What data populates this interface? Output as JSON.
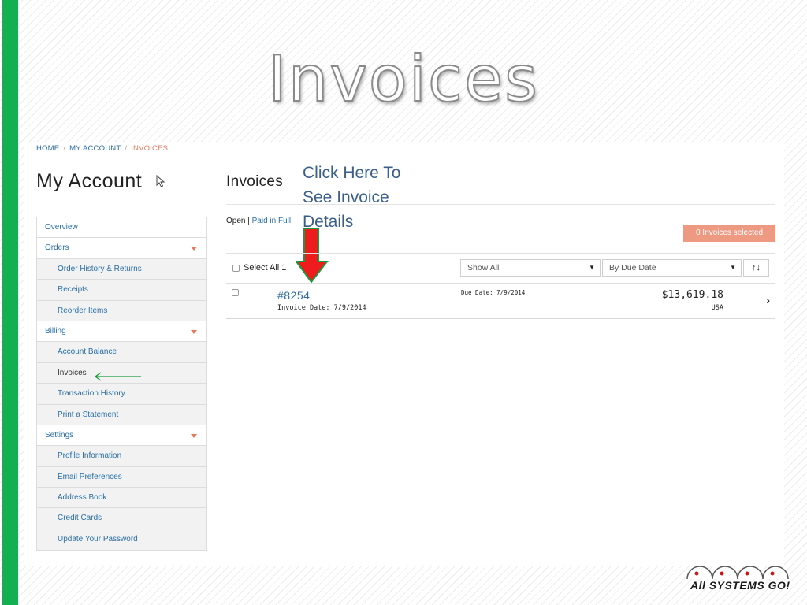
{
  "slide": {
    "title": "Invoices",
    "annotation": "Click Here To See Invoice Details",
    "accent_color": "#12b050"
  },
  "breadcrumb": {
    "home": "HOME",
    "account": "MY ACCOUNT",
    "current": "INVOICES"
  },
  "account": {
    "title": "My Account"
  },
  "sidebar": {
    "items": [
      {
        "label": "Overview",
        "sub": false,
        "caret": false
      },
      {
        "label": "Orders",
        "sub": false,
        "caret": true
      },
      {
        "label": "Order History & Returns",
        "sub": true,
        "caret": false
      },
      {
        "label": "Receipts",
        "sub": true,
        "caret": false
      },
      {
        "label": "Reorder Items",
        "sub": true,
        "caret": false
      },
      {
        "label": "Billing",
        "sub": false,
        "caret": true
      },
      {
        "label": "Account Balance",
        "sub": true,
        "caret": false
      },
      {
        "label": "Invoices",
        "sub": true,
        "caret": false
      },
      {
        "label": "Transaction History",
        "sub": true,
        "caret": false
      },
      {
        "label": "Print a Statement",
        "sub": true,
        "caret": false
      },
      {
        "label": "Settings",
        "sub": false,
        "caret": true
      },
      {
        "label": "Profile Information",
        "sub": true,
        "caret": false
      },
      {
        "label": "Email Preferences",
        "sub": true,
        "caret": false
      },
      {
        "label": "Address Book",
        "sub": true,
        "caret": false
      },
      {
        "label": "Credit Cards",
        "sub": true,
        "caret": false
      },
      {
        "label": "Update Your Password",
        "sub": true,
        "caret": false
      }
    ]
  },
  "invoices": {
    "heading": "Invoices",
    "filter_open": "Open",
    "filter_sep": "|",
    "filter_paid": "Paid in Full",
    "selected_badge": "0 Invoices selected",
    "select_all": "Select All 1",
    "show_filter": "Show All",
    "sort_by": "By Due Date",
    "sort_icon": "↑↓",
    "rows": [
      {
        "number": "#8254",
        "invoice_date": "Invoice Date: 7/9/2014",
        "due_date": "Due Date: 7/9/2014",
        "amount": "$13,619.18",
        "currency": "USA"
      }
    ]
  },
  "logo": {
    "text": "All SYSTEMS GO!"
  }
}
